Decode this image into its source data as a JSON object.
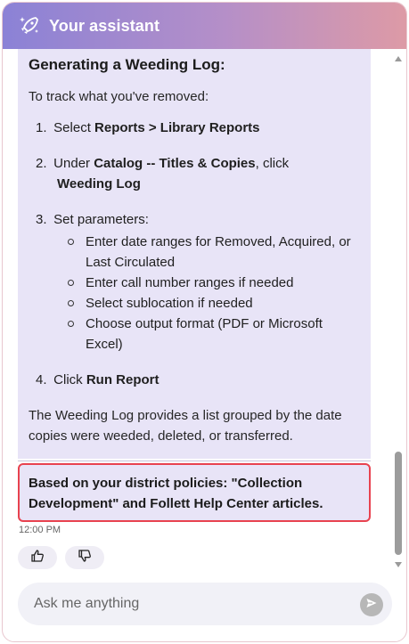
{
  "header": {
    "title": "Your assistant",
    "logo_icon": "sparkle-rocket-icon"
  },
  "message": {
    "heading": "Generating a Weeding Log:",
    "intro": "To track what you've removed:",
    "steps": [
      {
        "num": "1.",
        "pre": "Select ",
        "bold": "Reports > Library Reports"
      },
      {
        "num": "2.",
        "pre": "Under ",
        "bold": "Catalog -- Titles & Copies",
        "post": ", click",
        "bold2": "Weeding Log"
      },
      {
        "num": "3.",
        "pre": "Set parameters:",
        "bullets": [
          "Enter date ranges for Removed, Acquired, or Last Circulated",
          "Enter call number ranges if needed",
          "Select sublocation if needed",
          "Choose output format (PDF or Microsoft Excel)"
        ]
      },
      {
        "num": "4.",
        "pre": "Click ",
        "bold": "Run Report"
      }
    ],
    "summary": "The Weeding Log provides a list grouped by the date copies were weeded, deleted, or transferred."
  },
  "sources": {
    "text": "Based on your district policies: \"Collection Development\" and Follett Help Center articles."
  },
  "timestamp": "12:00 PM",
  "feedback": {
    "up_icon": "thumbs-up-icon",
    "down_icon": "thumbs-down-icon"
  },
  "composer": {
    "placeholder": "Ask me anything",
    "send_icon": "send-icon"
  },
  "colors": {
    "accent": "#8b82d6",
    "bubble": "#e8e4f7",
    "highlight": "#e8424f"
  }
}
